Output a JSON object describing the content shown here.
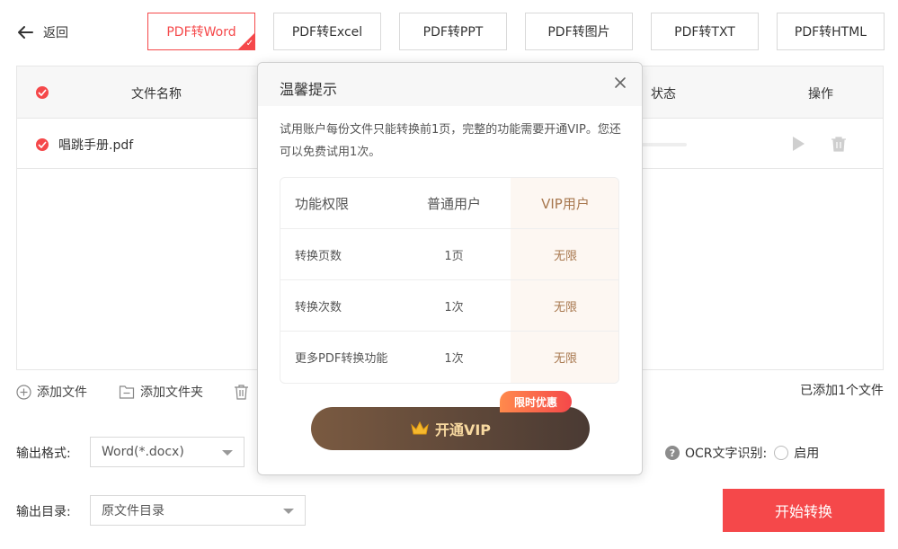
{
  "header": {
    "back_label": "返回",
    "tabs": [
      {
        "label": "PDF转Word",
        "active": true
      },
      {
        "label": "PDF转Excel",
        "active": false
      },
      {
        "label": "PDF转PPT",
        "active": false
      },
      {
        "label": "PDF转图片",
        "active": false
      },
      {
        "label": "PDF转TXT",
        "active": false
      },
      {
        "label": "PDF转HTML",
        "active": false
      }
    ]
  },
  "file_table": {
    "columns": {
      "name": "文件名称",
      "status": "状态",
      "action": "操作"
    },
    "rows": [
      {
        "name": "唱跳手册.pdf",
        "checked": true,
        "progress": 0
      }
    ]
  },
  "actions": {
    "add_file": "添加文件",
    "add_folder": "添加文件夹",
    "added_count": "已添加1个文件"
  },
  "output": {
    "format_label": "输出格式:",
    "format_value": "Word(*.docx)",
    "dir_label": "输出目录:",
    "dir_value": "原文件目录",
    "ocr_label": "OCR文字识别:",
    "ocr_enable": "启用",
    "start_button": "开始转换"
  },
  "modal": {
    "title": "温馨提示",
    "description": "试用账户每份文件只能转换前1页，完整的功能需要开通VIP。您还可以免费试用1次。",
    "table": {
      "headers": [
        "功能权限",
        "普通用户",
        "VIP用户"
      ],
      "rows": [
        [
          "转换页数",
          "1页",
          "无限"
        ],
        [
          "转换次数",
          "1次",
          "无限"
        ],
        [
          "更多PDF转换功能",
          "1次",
          "无限"
        ]
      ]
    },
    "vip_button": "开通VIP",
    "promo_badge": "限时优惠"
  },
  "colors": {
    "accent": "#f5484a",
    "vip_gold": "#a8784f",
    "vip_button": "#5c4538"
  },
  "icons": [
    "arrow-left-icon",
    "check-icon",
    "play-icon",
    "trash-icon",
    "plus-circle-icon",
    "folder-icon",
    "question-icon",
    "close-icon",
    "crown-icon"
  ]
}
